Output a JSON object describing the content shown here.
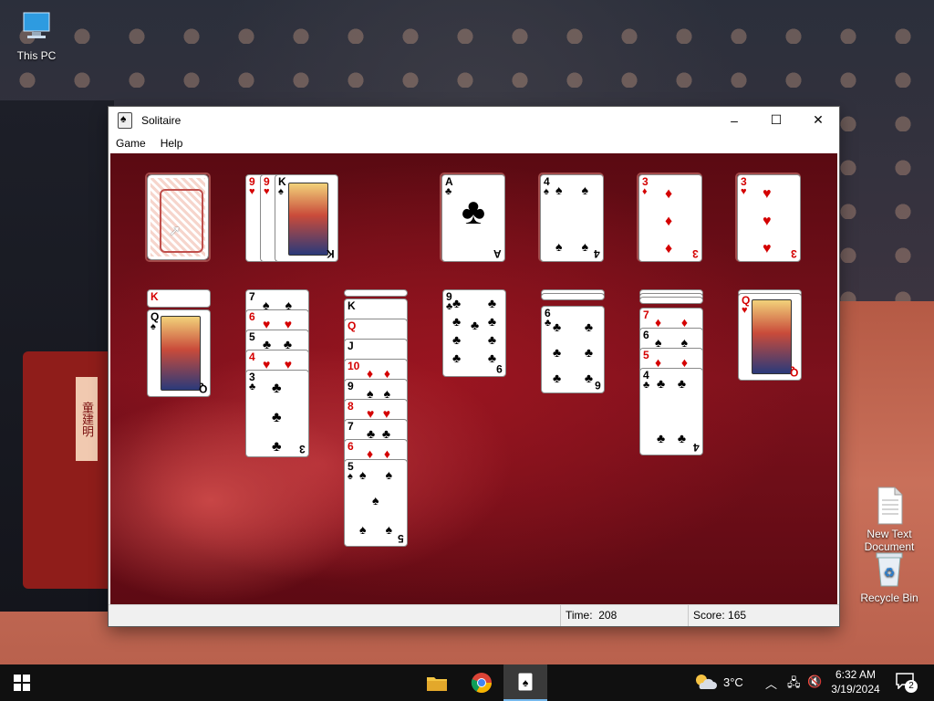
{
  "desktop": {
    "icons": [
      {
        "label": "This PC",
        "icon": "computer-icon"
      },
      {
        "label": "New Text\nDocument",
        "icon": "text-file-icon"
      },
      {
        "label": "Recycle Bin",
        "icon": "recycle-bin-icon"
      }
    ],
    "wallpaper_text": "童建明"
  },
  "window": {
    "title": "Solitaire",
    "menu": [
      "Game",
      "Help"
    ],
    "controls": {
      "minimize": "–",
      "maximize": "☐",
      "close": "✕"
    },
    "status": {
      "time_label": "Time:",
      "time_value": "208",
      "score_label": "Score:",
      "score_value": "165"
    }
  },
  "game": {
    "stock": {
      "face": "down"
    },
    "waste": [
      "9♥",
      "9♥",
      "K♠"
    ],
    "foundations": [
      {
        "rank": "A",
        "suit": "♣",
        "color": "black"
      },
      {
        "rank": "4",
        "suit": "♠",
        "color": "black"
      },
      {
        "rank": "3",
        "suit": "♦",
        "color": "red"
      },
      {
        "rank": "3",
        "suit": "♥",
        "color": "red"
      }
    ],
    "tableau": [
      {
        "cards": [
          [
            "K",
            "♥"
          ],
          [
            "Q",
            "♠"
          ]
        ]
      },
      {
        "cards": [
          [
            "7",
            "♠"
          ],
          [
            "6",
            "♥"
          ],
          [
            "5",
            "♠"
          ],
          [
            "4",
            "♥"
          ],
          [
            "3",
            "♣"
          ]
        ]
      },
      {
        "cards": [
          [
            "K",
            "♣"
          ],
          [
            "Q",
            "♥"
          ],
          [
            "J",
            "♣"
          ],
          [
            "10",
            "♦"
          ],
          [
            "9",
            "♠"
          ],
          [
            "8",
            "♥"
          ],
          [
            "7",
            "♣"
          ],
          [
            "6",
            "♦"
          ],
          [
            "5",
            "♠"
          ]
        ]
      },
      {
        "cards": [
          [
            "9",
            "♣"
          ]
        ]
      },
      {
        "cards": [
          [
            "6",
            "♣"
          ]
        ]
      },
      {
        "cards": [
          [
            "7",
            "♦"
          ],
          [
            "6",
            "♠"
          ],
          [
            "5",
            "♦"
          ],
          [
            "4",
            "♣"
          ]
        ]
      },
      {
        "cards": [
          [
            "Q",
            "♥"
          ]
        ]
      }
    ]
  },
  "taskbar": {
    "weather": "3°C",
    "time": "6:32 AM",
    "date": "3/19/2024",
    "notifications": "2",
    "apps": [
      "file-explorer-icon",
      "chrome-icon",
      "solitaire-icon"
    ]
  }
}
